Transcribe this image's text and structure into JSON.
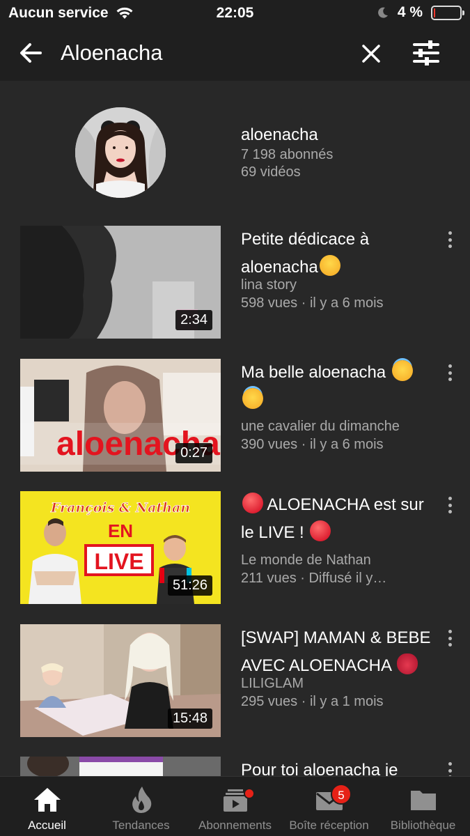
{
  "status_bar": {
    "carrier": "Aucun service",
    "time": "22:05",
    "battery_text": "4 %",
    "battery_level": 0.04,
    "colors": {
      "battery_low": "#ff3b30"
    }
  },
  "search": {
    "query": "Aloenacha",
    "back_icon": "back-arrow-icon",
    "clear_icon": "close-icon",
    "filter_icon": "filter-sliders-icon"
  },
  "channel": {
    "name": "aloenacha",
    "subscribers": "7 198 abonnés",
    "videos": "69 vidéos"
  },
  "videos": [
    {
      "title": "Petite dédicace à aloenacha",
      "emoji": "smile",
      "channel": "lina story",
      "meta": "598 vues · il y a 6 mois",
      "duration": "2:34"
    },
    {
      "title": "Ma belle aloenacha",
      "emoji": "halo",
      "channel": "une cavalier du dimanche",
      "meta": "390 vues · il y a 6 mois",
      "duration": "0:27",
      "thumb_text": "aloenacha"
    },
    {
      "title_prefix_emoji": "red-circle",
      "title": "ALOENACHA est sur le LIVE !",
      "emoji": "red-circle",
      "channel": "Le monde de Nathan",
      "meta": "211 vues · Diffusé il y…",
      "duration": "51:26",
      "thumb_title": "François & Nathan",
      "thumb_en": "EN",
      "thumb_live": "LIVE"
    },
    {
      "title": "[SWAP] MAMAN & BEBE AVEC ALOENACHA",
      "emoji": "kiss",
      "channel": "LILIGLAM",
      "meta": "295 vues · il y a 1 mois",
      "duration": "15:48"
    },
    {
      "title": "Pour toi aloenacha je"
    }
  ],
  "tabs": [
    {
      "label": "Accueil",
      "icon": "home-icon",
      "active": true
    },
    {
      "label": "Tendances",
      "icon": "flame-icon"
    },
    {
      "label": "Abonnements",
      "icon": "subscriptions-icon",
      "has_dot": true
    },
    {
      "label": "Boîte réception",
      "icon": "inbox-icon",
      "badge": "5"
    },
    {
      "label": "Bibliothèque",
      "icon": "folder-icon"
    }
  ],
  "colors": {
    "background": "#282828",
    "bars": "#1f1f1f",
    "secondary_text": "#aaaaaa",
    "badge": "#e62117"
  }
}
